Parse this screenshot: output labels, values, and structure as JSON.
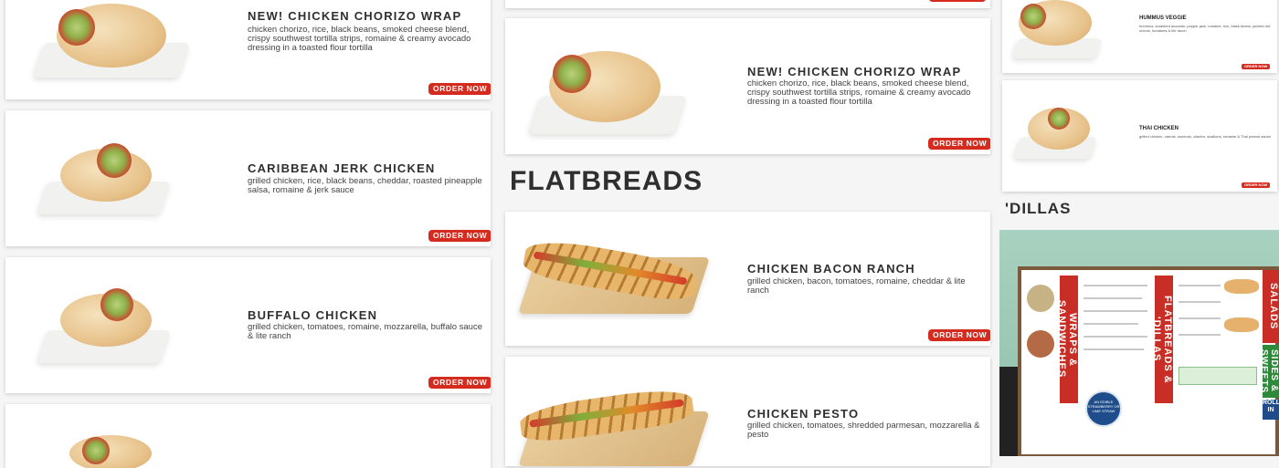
{
  "left_column": {
    "items": [
      {
        "title": "NEW! CHICKEN CHORIZO WRAP",
        "desc": "chicken chorizo, rice, black beans, smoked cheese blend, crispy southwest tortilla strips, romaine & creamy avocado dressing in a toasted flour tortilla",
        "order": "ORDER NOW"
      },
      {
        "title": "CARIBBEAN JERK CHICKEN",
        "desc": "grilled chicken, rice, black beans, cheddar, roasted pineapple salsa, romaine & jerk sauce",
        "order": "ORDER NOW"
      },
      {
        "title": "BUFFALO CHICKEN",
        "desc": "grilled chicken, tomatoes, romaine, mozzarella, buffalo sauce & lite ranch",
        "order": "ORDER NOW"
      }
    ]
  },
  "middle_column": {
    "featured": {
      "title": "NEW! CHICKEN CHORIZO WRAP",
      "desc": "chicken chorizo, rice, black beans, smoked cheese blend, crispy southwest tortilla strips, romaine & creamy avocado dressing in a toasted flour tortilla",
      "order": "ORDER NOW"
    },
    "section_heading": "FLATBREADS",
    "items": [
      {
        "title": "CHICKEN BACON RANCH",
        "desc": "grilled chicken, bacon, tomatoes, romaine, cheddar & lite ranch",
        "order": "ORDER NOW"
      },
      {
        "title": "CHICKEN PESTO",
        "desc": "grilled chicken, tomatoes, shredded parmesan, mozzarella & pesto"
      }
    ]
  },
  "right_column": {
    "items": [
      {
        "title": "HUMMUS VEGGIE",
        "desc": "hummus, smashed avocado, pepper jack, romaine, rice, black beans, pickled red onions, tomatoes & lite ranch",
        "order": "ORDER NOW"
      },
      {
        "title": "THAI CHICKEN",
        "desc": "grilled chicken, carrots, wontons, cilantro, scallions, romaine & Thai peanut sauce",
        "order": "ORDER NOW"
      }
    ],
    "section_heading": "'DILLAS",
    "photo": {
      "strips": [
        "WRAPS & SANDWICHES",
        "FLATBREADS & 'DILLAS",
        "SALADS",
        "SIDES & SWEETS",
        "ROLL IN"
      ],
      "badge": "AN EDIBLE STRAWBERRY OR LIME STRAW"
    }
  }
}
